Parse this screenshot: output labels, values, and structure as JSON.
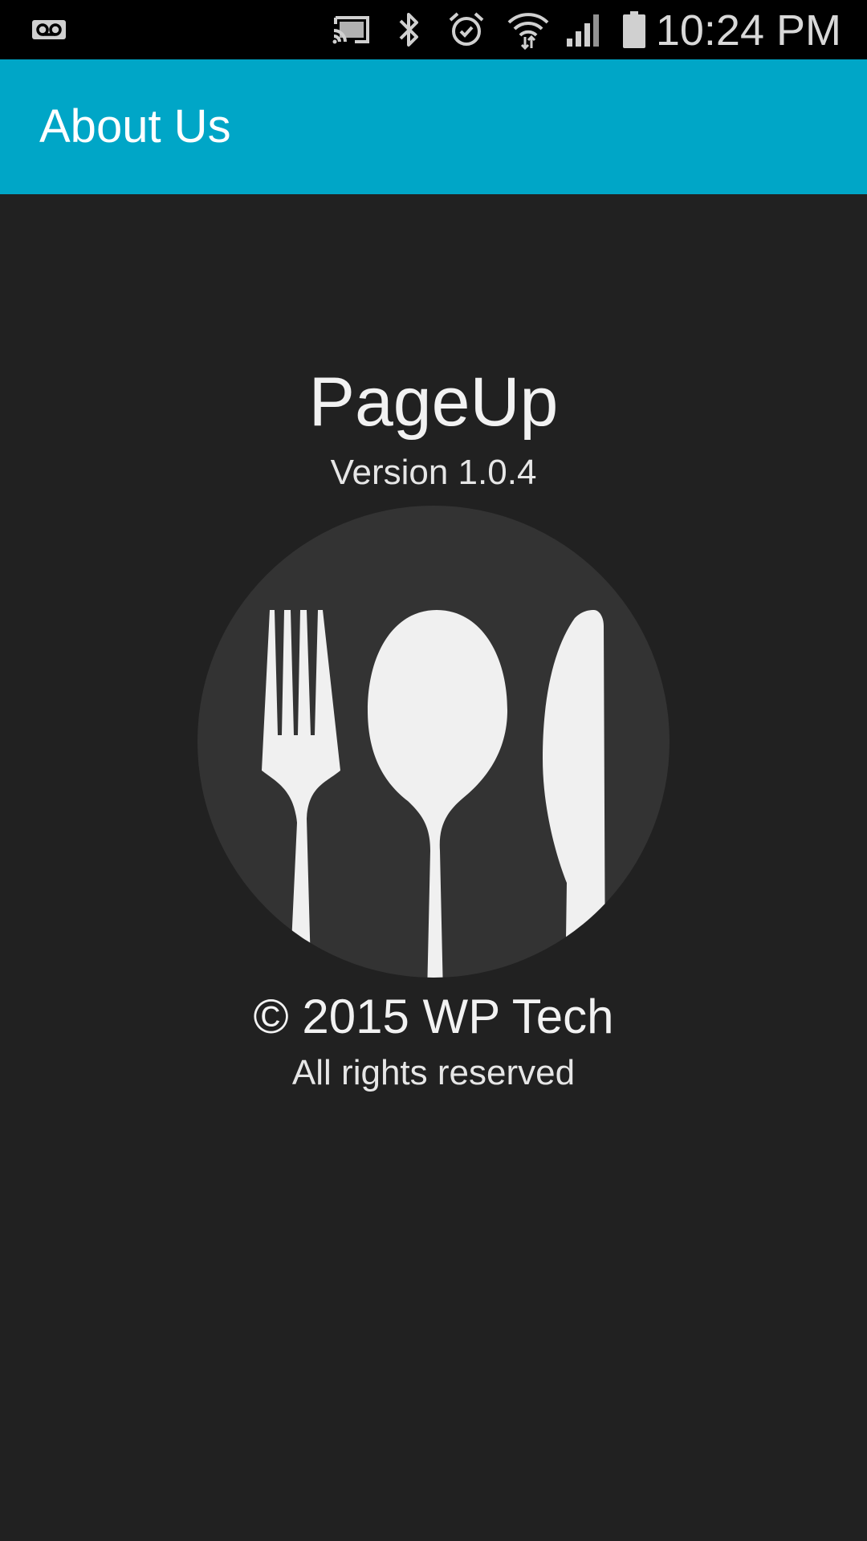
{
  "status_bar": {
    "time": "10:24 PM",
    "icons": [
      "voicemail-icon",
      "cast-icon",
      "bluetooth-icon",
      "alarm-icon",
      "wifi-icon",
      "cell-signal-icon",
      "battery-icon"
    ]
  },
  "app_bar": {
    "title": "About Us",
    "color": "#00a6c7"
  },
  "about": {
    "app_name": "PageUp",
    "version": "Version 1.0.4",
    "copyright": "© 2015 WP Tech",
    "rights": "All rights reserved"
  },
  "logo": {
    "icon": "cutlery-icon",
    "circle_color": "#333333",
    "utensil_color": "#f0f0f0"
  }
}
